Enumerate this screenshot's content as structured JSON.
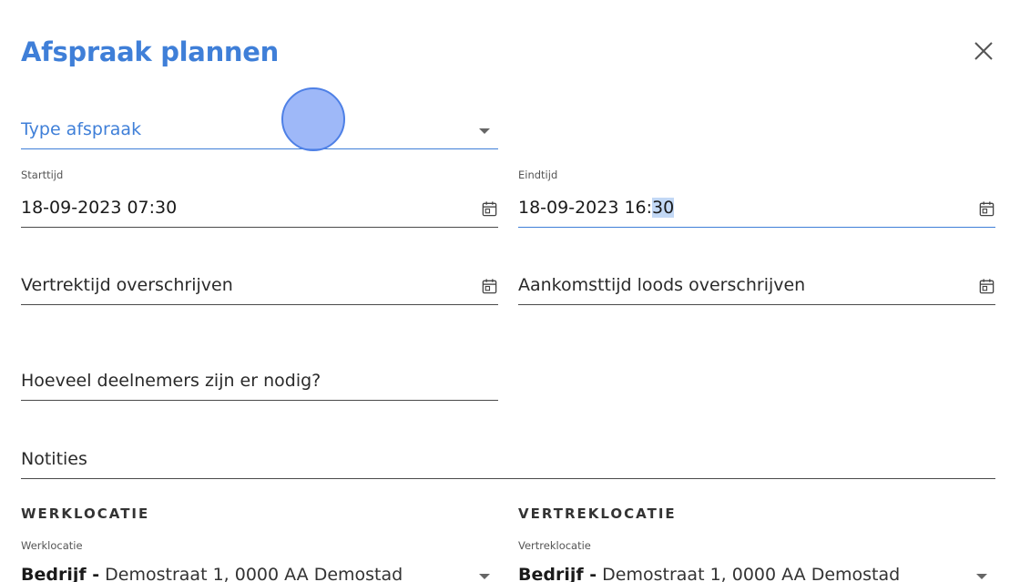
{
  "dialog": {
    "title": "Afspraak plannen"
  },
  "type_field": {
    "placeholder": "Type afspraak"
  },
  "start": {
    "label": "Starttijd",
    "value": "18-09-2023 07:30"
  },
  "end": {
    "label": "Eindtijd",
    "value_prefix": "18-09-2023 16:",
    "value_selected": "30"
  },
  "departure": {
    "placeholder": "Vertrektijd overschrijven"
  },
  "arrival": {
    "placeholder": "Aankomsttijd loods overschrijven"
  },
  "participants": {
    "placeholder": "Hoeveel deelnemers zijn er nodig?"
  },
  "notes": {
    "placeholder": "Notities"
  },
  "work_location": {
    "heading": "WERKLOCATIE",
    "label": "Werklocatie",
    "company": "Bedrijf -",
    "address": " Demostraat 1, 0000 AA Demostad"
  },
  "departure_location": {
    "heading": "VERTREKLOCATIE",
    "label": "Vertreklocatie",
    "company": "Bedrijf -",
    "address": " Demostraat 1, 0000 AA Demostad"
  },
  "colors": {
    "accent": "#3f7fd8",
    "selection": "#c2d8f5"
  }
}
